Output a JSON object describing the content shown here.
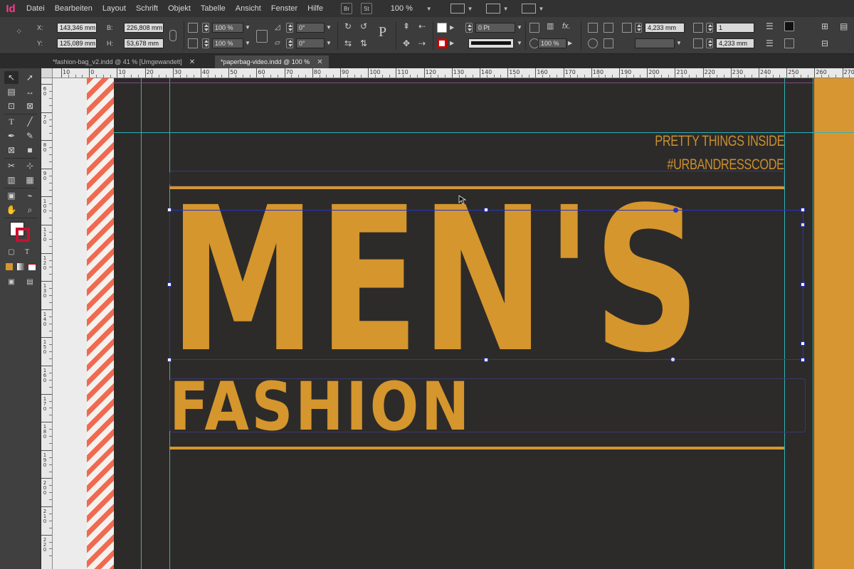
{
  "app": {
    "logo": "Id"
  },
  "menubar": {
    "items": [
      "Datei",
      "Bearbeiten",
      "Layout",
      "Schrift",
      "Objekt",
      "Tabelle",
      "Ansicht",
      "Fenster",
      "Hilfe"
    ],
    "bridge_label": "Br",
    "stock_label": "St",
    "zoom": "100 %"
  },
  "control": {
    "x_label": "X:",
    "x_value": "143,346 mm",
    "y_label": "Y:",
    "y_value": "125,089 mm",
    "w_label": "B:",
    "w_value": "226,808 mm",
    "h_label": "H:",
    "h_value": "53,678 mm",
    "scale_x": "100 %",
    "scale_y": "100 %",
    "rotation": "0°",
    "shear": "0°",
    "stroke_weight": "0 Pt",
    "opacity": "100 %",
    "ref_w": "4,233 mm",
    "ref_h": "4,233 mm",
    "columns": "1"
  },
  "tabs": [
    {
      "label": "*fashion-bag_v2.indd @ 41 % [Umgewandelt]"
    },
    {
      "label": "*paperbag-video.indd @ 100 %"
    }
  ],
  "ruler": {
    "top_labels": [
      "10",
      "0",
      "10",
      "20",
      "30",
      "40",
      "50",
      "60",
      "70",
      "80",
      "90",
      "100",
      "110",
      "120",
      "130",
      "140",
      "150",
      "160",
      "170",
      "180",
      "190",
      "200",
      "210",
      "220",
      "230",
      "240",
      "250",
      "260",
      "270"
    ],
    "left_labels": [
      "60",
      "70",
      "80",
      "90",
      "100",
      "110",
      "120",
      "130",
      "140",
      "150",
      "160",
      "170",
      "180",
      "190",
      "200",
      "210",
      "220"
    ]
  },
  "document": {
    "tagline_1": "PRETTY THINGS INSIDE",
    "tagline_2": "#URBANDRESSCODE",
    "headline": "MEN'S",
    "subhead": "FASHION"
  },
  "colors": {
    "accent_orange": "#d5962e",
    "page_background": "#2d2b29",
    "stripe_red": "#f06a50",
    "guide_cyan": "#2bb3b8",
    "selection_blue": "#2a33c2"
  }
}
